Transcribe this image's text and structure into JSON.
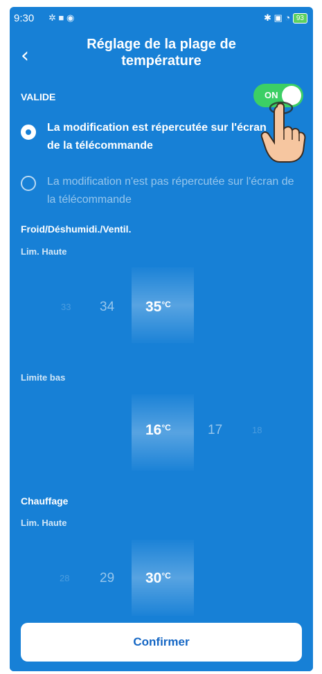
{
  "status": {
    "time": "9:30",
    "battery": "93"
  },
  "header": {
    "title": "Réglage de la plage de température"
  },
  "valide": {
    "label": "VALIDE",
    "toggle_label": "ON"
  },
  "options": [
    {
      "text": "La modification est répercutée sur l'écran de la télécommande",
      "selected": true
    },
    {
      "text": "La modification n'est pas répercutée sur l'écran de la télécommande",
      "selected": false
    }
  ],
  "cool": {
    "section": "Froid/Déshumidi./Ventil.",
    "high": {
      "label": "Lim. Haute",
      "prev2": "33",
      "prev1": "34",
      "value": "35",
      "unit": "°C"
    },
    "low": {
      "label": "Limite bas",
      "value": "16",
      "unit": "°C",
      "next1": "17",
      "next2": "18"
    }
  },
  "heat": {
    "section": "Chauffage",
    "high": {
      "label": "Lim. Haute",
      "prev2": "28",
      "prev1": "29",
      "value": "30",
      "unit": "°C"
    }
  },
  "footer": {
    "confirm_label": "Confirmer"
  }
}
